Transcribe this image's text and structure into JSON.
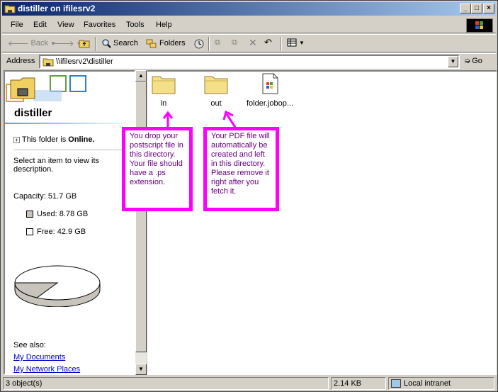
{
  "window": {
    "title": "distiller on ifilesrv2"
  },
  "menu": {
    "items": [
      "File",
      "Edit",
      "View",
      "Favorites",
      "Tools",
      "Help"
    ]
  },
  "toolbar": {
    "back": "Back",
    "search": "Search",
    "folders": "Folders"
  },
  "address": {
    "label": "Address",
    "value": "\\\\ifilesrv2\\distiller",
    "go": "Go"
  },
  "left_pane": {
    "folder_name": "distiller",
    "online_prefix": "This folder is ",
    "online_status": "Online.",
    "prompt": "Select an item to view its description.",
    "capacity": "Capacity: 51.7 GB",
    "used": "Used: 8.78 GB",
    "free": "Free: 42.9 GB",
    "used_fraction": 0.17,
    "see_also": "See also:",
    "links": [
      "My Documents",
      "My Network Places"
    ]
  },
  "files": [
    {
      "name": "in",
      "icon": "folder-icon"
    },
    {
      "name": "out",
      "icon": "folder-icon"
    },
    {
      "name": "folder.jobop...",
      "icon": "joboptions-file-icon"
    }
  ],
  "annotations": {
    "in_note": "You drop your postscript file in this directory. Your file should have a .ps extension.",
    "out_note": "Your PDF file will automatically be created and left in this directory. Please remove it right after you fetch it.",
    "accent_color": "#ff00ff"
  },
  "status": {
    "objects": "3 object(s)",
    "size": "2.14 KB",
    "zone": "Local intranet"
  }
}
